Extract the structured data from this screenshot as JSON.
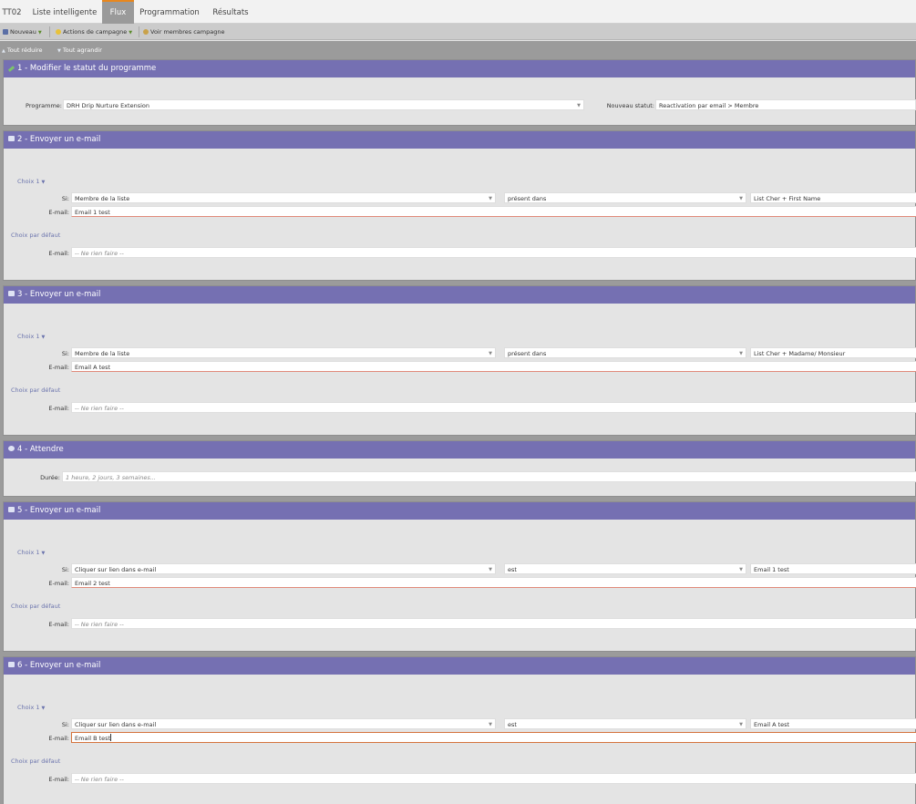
{
  "tabs": [
    {
      "label": "TT02"
    },
    {
      "label": "Liste intelligente"
    },
    {
      "label": "Flux"
    },
    {
      "label": "Programmation"
    },
    {
      "label": "Résultats"
    }
  ],
  "toolbar": {
    "nouveau": "Nouveau",
    "actions": "Actions de campagne",
    "voir": "Voir membres campagne"
  },
  "subbar": {
    "reduire": "Tout réduire",
    "agrandir": "Tout agrandir"
  },
  "steps": {
    "s1": {
      "title": "1 - Modifier le statut du programme",
      "programme_label": "Programme:",
      "programme_value": "DRH Drip Nurture Extension",
      "statut_label": "Nouveau statut:",
      "statut_value": "Reactivation par email > Membre"
    },
    "s2": {
      "title": "2 - Envoyer un e-mail",
      "choix": "Choix 1",
      "si_label": "Si:",
      "cond1": "Membre de la liste",
      "cond2": "présent dans",
      "cond3": "List Cher + First Name",
      "email_label": "E-mail:",
      "email_value": "Email 1 test",
      "default_label": "Choix par défaut",
      "default_email_label": "E-mail:",
      "default_value": "-- Ne rien faire --"
    },
    "s3": {
      "title": "3 - Envoyer un e-mail",
      "choix": "Choix 1",
      "si_label": "Si:",
      "cond1": "Membre de la liste",
      "cond2": "présent dans",
      "cond3": "List Cher + Madame/ Monsieur",
      "email_label": "E-mail:",
      "email_value": "Email A test",
      "default_label": "Choix par défaut",
      "default_email_label": "E-mail:",
      "default_value": "-- Ne rien faire --"
    },
    "s4": {
      "title": "4 - Attendre",
      "duree_label": "Durée:",
      "duree_placeholder": "1 heure, 2 jours, 3 semaines..."
    },
    "s5": {
      "title": "5 - Envoyer un e-mail",
      "choix": "Choix 1",
      "si_label": "Si:",
      "cond1": "Cliquer sur lien dans e-mail",
      "cond2": "est",
      "cond3": "Email 1 test",
      "email_label": "E-mail:",
      "email_value": "Email 2 test",
      "default_label": "Choix par défaut",
      "default_email_label": "E-mail:",
      "default_value": "-- Ne rien faire --"
    },
    "s6": {
      "title": "6 - Envoyer un e-mail",
      "choix": "Choix 1",
      "si_label": "Si:",
      "cond1": "Cliquer sur lien dans e-mail",
      "cond2": "est",
      "cond3": "Email A test",
      "email_label": "E-mail:",
      "email_value": "Email B test",
      "default_label": "Choix par défaut",
      "default_email_label": "E-mail:",
      "default_value": "-- Ne rien faire --"
    }
  },
  "colors": {
    "header": "#7570b2",
    "active_tab": "#9a9a9a",
    "active_tab_accent": "#e8871e",
    "link": "#6b74ad"
  }
}
